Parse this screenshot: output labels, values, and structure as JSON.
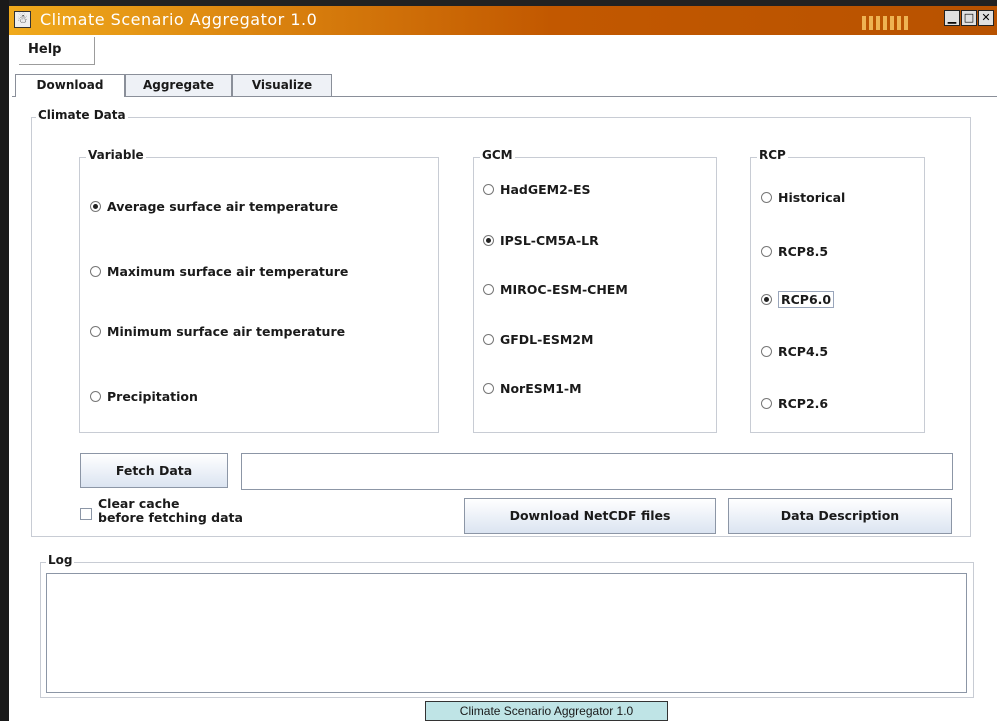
{
  "window": {
    "title": "Climate Scenario Aggregator 1.0",
    "minimize_glyph": "▁",
    "maximize_glyph": "□",
    "close_glyph": "✕"
  },
  "menu": {
    "help": "Help"
  },
  "tabs": [
    {
      "label": "Download",
      "selected": true
    },
    {
      "label": "Aggregate",
      "selected": false
    },
    {
      "label": "Visualize",
      "selected": false
    }
  ],
  "climate_data": {
    "title": "Climate Data",
    "variable": {
      "title": "Variable",
      "options": [
        {
          "label": "Average surface air temperature",
          "selected": true
        },
        {
          "label": "Maximum surface air temperature",
          "selected": false
        },
        {
          "label": "Minimum surface air temperature",
          "selected": false
        },
        {
          "label": "Precipitation",
          "selected": false
        }
      ]
    },
    "gcm": {
      "title": "GCM",
      "options": [
        {
          "label": "HadGEM2-ES",
          "selected": false
        },
        {
          "label": "IPSL-CM5A-LR",
          "selected": true
        },
        {
          "label": "MIROC-ESM-CHEM",
          "selected": false
        },
        {
          "label": "GFDL-ESM2M",
          "selected": false
        },
        {
          "label": "NorESM1-M",
          "selected": false
        }
      ]
    },
    "rcp": {
      "title": "RCP",
      "options": [
        {
          "label": "Historical",
          "selected": false
        },
        {
          "label": "RCP8.5",
          "selected": false
        },
        {
          "label": "RCP6.0",
          "selected": true
        },
        {
          "label": "RCP4.5",
          "selected": false
        },
        {
          "label": "RCP2.6",
          "selected": false
        }
      ]
    },
    "fetch_button": "Fetch Data",
    "fetch_status_value": "",
    "clear_cache_line1": "Clear cache",
    "clear_cache_line2": "before fetching data",
    "clear_cache_checked": false,
    "download_netcdf_button": "Download NetCDF files",
    "data_description_button": "Data Description"
  },
  "log": {
    "title": "Log",
    "content": ""
  },
  "tooltip": "Climate Scenario Aggregator 1.0"
}
